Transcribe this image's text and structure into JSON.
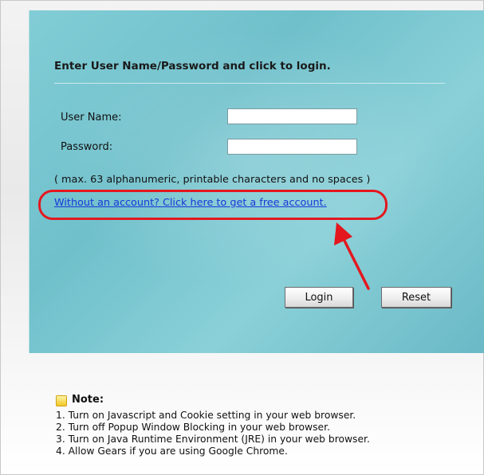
{
  "login": {
    "heading": "Enter User Name/Password and click to login.",
    "username_label": "User Name:",
    "username_value": "",
    "password_label": "Password:",
    "password_value": "",
    "hint": "( max. 63 alphanumeric, printable characters and no spaces )",
    "free_account_link": "Without an account? Click here to get a free account.",
    "login_button": "Login",
    "reset_button": "Reset"
  },
  "note": {
    "title": "Note:",
    "items": [
      "1. Turn on Javascript and Cookie setting in your web browser.",
      "2. Turn off Popup Window Blocking in your web browser.",
      "3. Turn on Java Runtime Environment (JRE) in your web browser.",
      "4. Allow Gears if you are using Google Chrome."
    ]
  },
  "colors": {
    "panel": "#7cc6d0",
    "link": "#1a37d8",
    "callout": "#e4171f"
  },
  "icons": [
    "note-icon"
  ]
}
